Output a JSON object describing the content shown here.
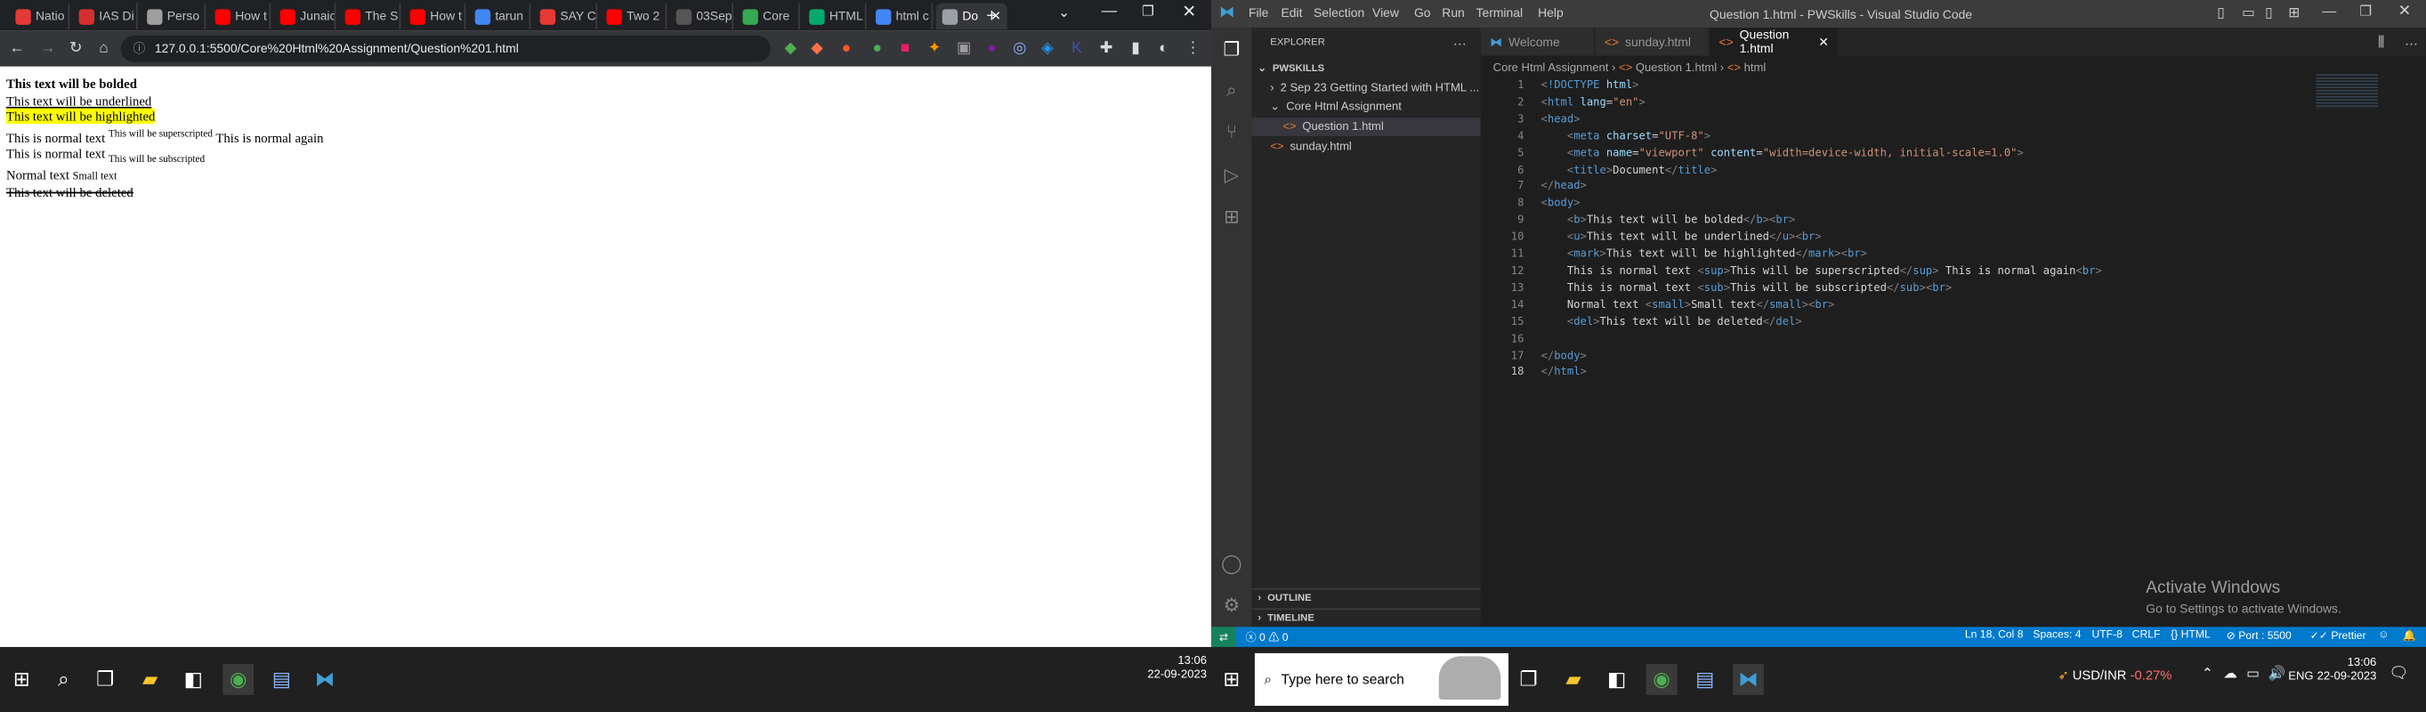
{
  "chrome": {
    "tabs": [
      {
        "label": "Natio",
        "icon": "flag-icon",
        "color": "#e53935"
      },
      {
        "label": "IAS Di",
        "icon": "ias-icon",
        "color": "#d32f2f"
      },
      {
        "label": "Perso",
        "icon": "page-icon",
        "color": "#9e9e9e"
      },
      {
        "label": "How t",
        "icon": "youtube-icon",
        "color": "#ff0000"
      },
      {
        "label": "Junaic",
        "icon": "youtube-icon",
        "color": "#ff0000"
      },
      {
        "label": "The S",
        "icon": "youtube-icon",
        "color": "#ff0000"
      },
      {
        "label": "How t",
        "icon": "youtube-icon",
        "color": "#ff0000"
      },
      {
        "label": "tarun",
        "icon": "google-icon",
        "color": "#4285f4"
      },
      {
        "label": "SAY C",
        "icon": "say-icon",
        "color": "#e53935"
      },
      {
        "label": "Two 2",
        "icon": "youtube-icon",
        "color": "#ff0000"
      },
      {
        "label": "03Sep",
        "icon": "doc-icon",
        "color": "#555"
      },
      {
        "label": "Core",
        "icon": "drive-icon",
        "color": "#34a853"
      },
      {
        "label": "HTML",
        "icon": "w3-icon",
        "color": "#04aa6d"
      },
      {
        "label": "html c",
        "icon": "google-icon",
        "color": "#4285f4"
      },
      {
        "label": "Do",
        "icon": "globe-icon",
        "color": "#9aa0a6"
      }
    ],
    "url": "127.0.0.1:5500/Core%20Html%20Assignment/Question%201.html"
  },
  "page": {
    "bold": "This text will be bolded",
    "underline": "This text will be underlined",
    "highlight": "This text will be highlighted",
    "normal1": "This is normal text ",
    "sup": "This will be superscripted",
    "normal_again": " This is normal again",
    "normal2": "This is normal text ",
    "sub": "This will be subscripted",
    "normal3": "Normal text ",
    "small": "Small text",
    "deleted": "This text will be deleted"
  },
  "vscode": {
    "title": "Question 1.html - PWSkills - Visual Studio Code",
    "menus": [
      "File",
      "Edit",
      "Selection",
      "View",
      "Go",
      "Run",
      "Terminal",
      "Help"
    ],
    "explorer_title": "EXPLORER",
    "root": "PWSKILLS",
    "tree": [
      {
        "label": "2 Sep 23 Getting Started with HTML ...",
        "indent": 1,
        "arrow": "›"
      },
      {
        "label": "Core Html Assignment",
        "indent": 1,
        "arrow": "⌄"
      },
      {
        "label": "Question 1.html",
        "indent": 2,
        "arrow": "<>"
      },
      {
        "label": "sunday.html",
        "indent": 1,
        "arrow": "<>"
      }
    ],
    "outline": "OUTLINE",
    "timeline": "TIMELINE",
    "tabs": [
      "Welcome",
      "sunday.html",
      "Question 1.html"
    ],
    "breadcrumb": [
      "Core Html Assignment",
      "Question 1.html",
      "html"
    ],
    "line_numbers": [
      "1",
      "2",
      "3",
      "4",
      "5",
      "6",
      "7",
      "8",
      "9",
      "10",
      "11",
      "12",
      "13",
      "14",
      "15",
      "16",
      "17",
      "18"
    ],
    "watermark_title": "Activate Windows",
    "watermark_sub": "Go to Settings to activate Windows.",
    "status": {
      "errors": "0 ⚠ 0",
      "position": "Ln 18, Col 8",
      "spaces": "Spaces: 4",
      "encoding": "UTF-8",
      "eol": "CRLF",
      "language": "HTML",
      "port": "Port : 5500",
      "prettier": "Prettier"
    },
    "code": [
      [
        "<",
        "!DOCTYPE",
        " html",
        ">"
      ]
    ]
  },
  "taskbar": {
    "left_time": "13:06",
    "left_date": "22-09-2023",
    "search_placeholder": "Type here to search",
    "ticker": "USD/INR",
    "ticker_change": "-0.27%",
    "lang": "ENG",
    "time": "13:06",
    "date": "22-09-2023"
  },
  "code_lines": [
    "<!DOCTYPE html>",
    "<html lang=\"en\">",
    "<head>",
    "    <meta charset=\"UTF-8\">",
    "    <meta name=\"viewport\" content=\"width=device-width, initial-scale=1.0\">",
    "    <title>Document</title>",
    "</head>",
    "<body>",
    "    <b>This text will be bolded</b><br>",
    "    <u>This text will be underlined</u><br>",
    "    <mark>This text will be highlighted</mark><br>",
    "    This is normal text <sup>This will be superscripted</sup> This is normal again<br>",
    "    This is normal text <sub>This will be subscripted</sub><br>",
    "    Normal text <small>Small text</small><br>",
    "    <del>This text will be deleted</del>",
    "",
    "</body>",
    "</html>"
  ]
}
